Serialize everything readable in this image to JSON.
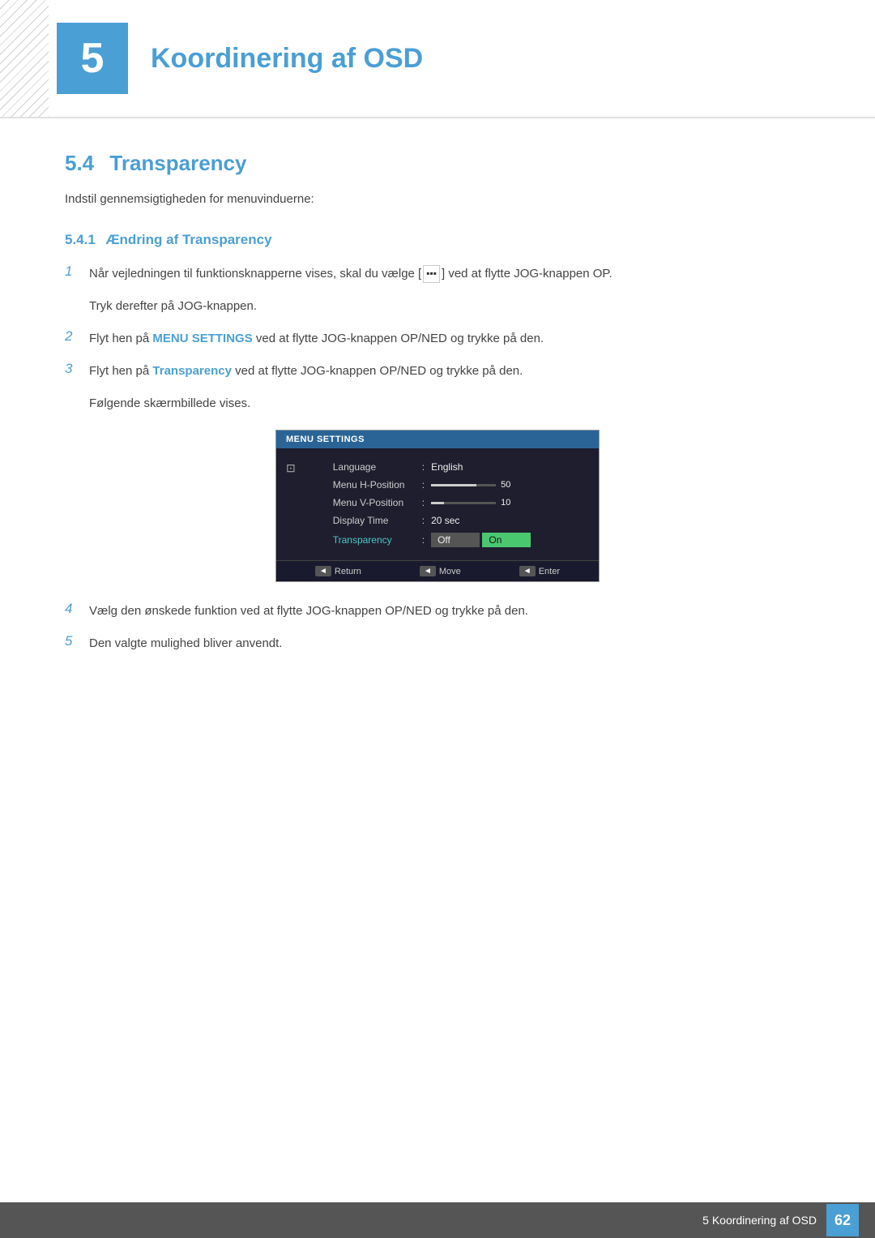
{
  "chapter": {
    "number": "5",
    "title": "Koordinering af OSD"
  },
  "section": {
    "number": "5.4",
    "title": "Transparency",
    "intro": "Indstil gennemsigtigheden for menuvinduerne:"
  },
  "subsection": {
    "number": "5.4.1",
    "title": "Ændring af Transparency"
  },
  "steps": [
    {
      "number": "1",
      "text_before": "Når vejledningen til funktionsknapperne vises, skal du vælge [",
      "icon_label": "☰☰☰",
      "text_after": "] ved at flytte JOG-knappen OP.",
      "continuation": "Tryk derefter på JOG-knappen."
    },
    {
      "number": "2",
      "text": "Flyt hen på ",
      "bold_teal": "MENU SETTINGS",
      "text2": " ved at flytte JOG-knappen OP/NED og trykke på den."
    },
    {
      "number": "3",
      "text": "Flyt hen på ",
      "bold_teal": "Transparency",
      "text2": " ved at flytte JOG-knappen OP/NED og trykke på den.",
      "continuation": "Følgende skærmbillede vises."
    },
    {
      "number": "4",
      "text": "Vælg den ønskede funktion ved at flytte JOG-knappen OP/NED og trykke på den."
    },
    {
      "number": "5",
      "text": "Den valgte mulighed bliver anvendt."
    }
  ],
  "osd": {
    "header": "MENU SETTINGS",
    "rows": [
      {
        "label": "Language",
        "value": "English",
        "type": "text"
      },
      {
        "label": "Menu H-Position",
        "value": "",
        "type": "slider",
        "fill": 70,
        "num": "50"
      },
      {
        "label": "Menu V-Position",
        "value": "",
        "type": "slider",
        "fill": 20,
        "num": "10"
      },
      {
        "label": "Display Time",
        "value": "20 sec",
        "type": "text"
      },
      {
        "label": "Transparency",
        "value": "",
        "type": "dropdown"
      }
    ],
    "dropdown_options": [
      "Off",
      "On"
    ],
    "footer": [
      {
        "btn": "◄",
        "label": "Return"
      },
      {
        "btn": "◄►",
        "label": "Move"
      },
      {
        "btn": "◄►",
        "label": "Enter"
      }
    ]
  },
  "footer": {
    "text": "5 Koordinering af OSD",
    "page": "62"
  }
}
